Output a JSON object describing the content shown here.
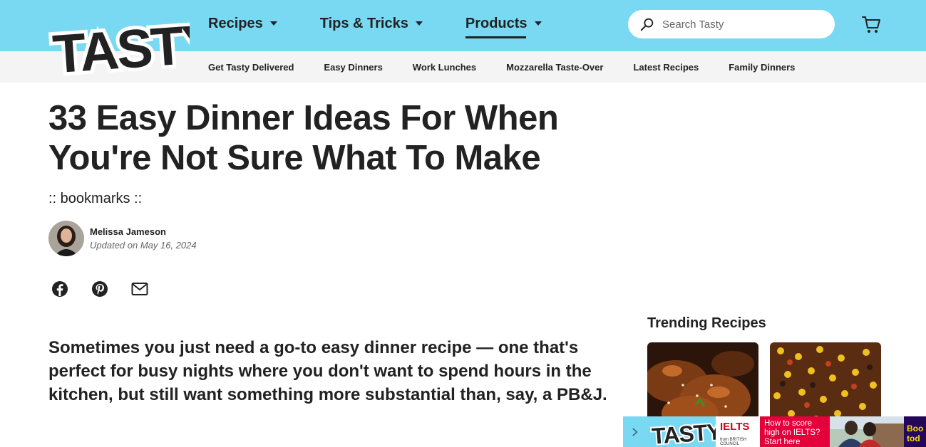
{
  "brand": {
    "logo_text": "TASTY",
    "accent": "#7ad9f2"
  },
  "nav": {
    "items": [
      {
        "label": "Recipes"
      },
      {
        "label": "Tips & Tricks"
      },
      {
        "label": "Products"
      }
    ],
    "active": "Products"
  },
  "search": {
    "placeholder": "Search Tasty",
    "icon": "search-icon"
  },
  "cart": {
    "icon": "cart-icon"
  },
  "subnav": {
    "items": [
      {
        "label": "Get Tasty Delivered"
      },
      {
        "label": "Easy Dinners"
      },
      {
        "label": "Work Lunches"
      },
      {
        "label": "Mozzarella Taste-Over"
      },
      {
        "label": "Latest Recipes"
      },
      {
        "label": "Family Dinners"
      }
    ]
  },
  "article": {
    "title": "33 Easy Dinner Ideas For When You're Not Sure What To Make",
    "bookmarks": ":: bookmarks ::",
    "author": {
      "name": "Melissa Jameson",
      "updated": "Updated on May 16, 2024"
    },
    "share": [
      "facebook-icon",
      "pinterest-icon",
      "email-icon"
    ],
    "intro": "Sometimes you just need a go-to easy dinner recipe — one that's perfect for busy nights where you don't want to spend hours in the kitchen, but still want something more substantial than, say, a PB&J."
  },
  "trending": {
    "title": "Trending Recipes"
  },
  "ad": {
    "brand": "IELTS",
    "from": "from BRITISH COUNCIL",
    "headline": "How to score high on IELTS? Start here",
    "cta": "Boo tod"
  }
}
